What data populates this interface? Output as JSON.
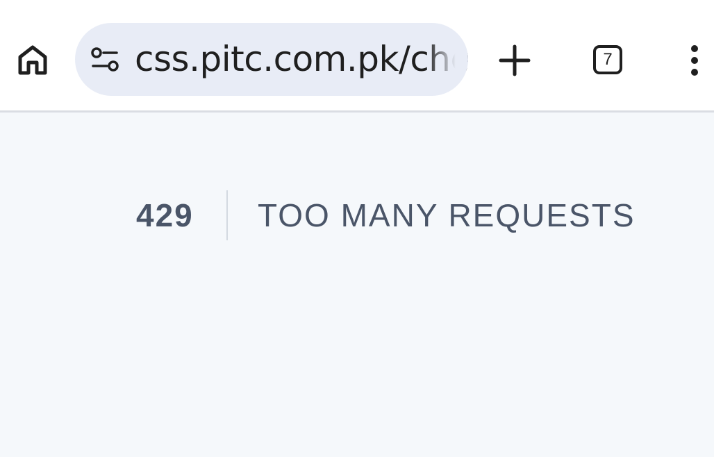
{
  "browser": {
    "url": "css.pitc.com.pk/che",
    "tab_count": "7",
    "icons": {
      "home": "home-icon",
      "site_info": "tune-icon",
      "new_tab": "plus-icon",
      "tab_switcher": "tab-switcher-icon",
      "menu": "more-vertical-icon"
    }
  },
  "error": {
    "code": "429",
    "message": "TOO MANY REQUESTS"
  },
  "colors": {
    "toolbar_bg": "#ffffff",
    "omnibox_bg": "#e8ecf6",
    "page_bg": "#f5f8fb",
    "error_text": "#4a5568"
  }
}
